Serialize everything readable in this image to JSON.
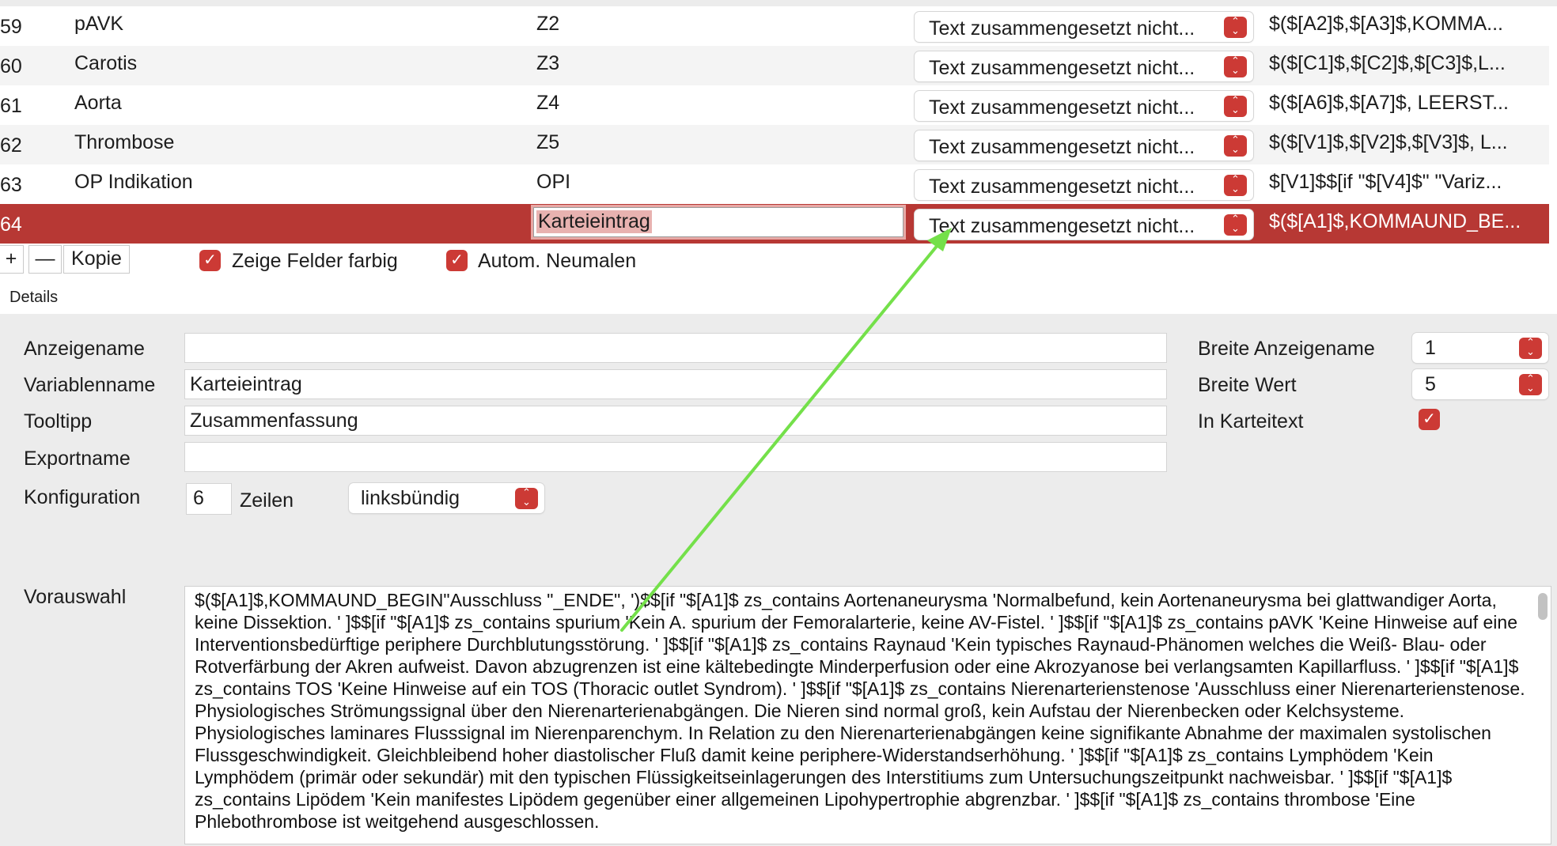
{
  "table": {
    "rows": [
      {
        "num": "59",
        "name": "pAVK",
        "var": "Z2",
        "function": "Text zusammengesetzt nicht...",
        "formula": "$($[A2]$,$[A3]$,KOMMA..."
      },
      {
        "num": "60",
        "name": "Carotis",
        "var": "Z3",
        "function": "Text zusammengesetzt nicht...",
        "formula": "$($[C1]$,$[C2]$,$[C3]$,L..."
      },
      {
        "num": "61",
        "name": "Aorta",
        "var": "Z4",
        "function": "Text zusammengesetzt nicht...",
        "formula": "$($[A6]$,$[A7]$, LEERST..."
      },
      {
        "num": "62",
        "name": "Thrombose",
        "var": "Z5",
        "function": "Text zusammengesetzt nicht...",
        "formula": "$($[V1]$,$[V2]$,$[V3]$, L..."
      },
      {
        "num": "63",
        "name": "OP Indikation",
        "var": "OPI",
        "function": "Text zusammengesetzt nicht...",
        "formula": "$[V1]$$[if \"$[V4]$\" \"Variz..."
      },
      {
        "num": "64",
        "name": "",
        "var": "Karteieintrag",
        "function": "Text zusammengesetzt nicht...",
        "formula": "$($[A1]$,KOMMAUND_BE..."
      }
    ]
  },
  "toolbar": {
    "add_label": "+",
    "remove_label": "—",
    "copy_label": "Kopie",
    "show_colors_label": "Zeige Felder farbig",
    "auto_repaint_label": "Autom. Neumalen",
    "show_colors_checked": true,
    "auto_repaint_checked": true
  },
  "details": {
    "section_title": "Details",
    "display_name_label": "Anzeigename",
    "display_name_value": "",
    "variable_name_label": "Variablenname",
    "variable_name_value": "Karteieintrag",
    "tooltip_label": "Tooltipp",
    "tooltip_value": "Zusammenfassung",
    "export_name_label": "Exportname",
    "export_name_value": "",
    "config_label": "Konfiguration",
    "config_lines_value": "6",
    "config_lines_unit": "Zeilen",
    "alignment_value": "linksbündig",
    "width_display_label": "Breite Anzeigename",
    "width_display_value": "1",
    "width_value_label": "Breite Wert",
    "width_value_value": "5",
    "in_record_label": "In Karteitext",
    "in_record_checked": true,
    "preselection_label": "Vorauswahl",
    "preselection_text": "$($[A1]$,KOMMAUND_BEGIN\"Ausschluss \"_ENDE\", ')$$[if \"$[A1]$ zs_contains Aortenaneurysma 'Normalbefund, kein Aortenaneurysma bei glattwandiger Aorta, keine Dissektion. ' ]$$[if \"$[A1]$ zs_contains spurium 'Kein A. spurium der Femoralarterie, keine AV-Fistel. ' ]$$[if \"$[A1]$ zs_contains pAVK 'Keine Hinweise auf eine Interventionsbedürftige periphere Durchblutungsstörung. ' ]$$[if \"$[A1]$ zs_contains Raynaud 'Kein typisches Raynaud-Phänomen welches die Weiß- Blau- oder Rotverfärbung der Akren aufweist. Davon abzugrenzen ist eine kältebedingte Minderperfusion oder eine Akrozyanose bei verlangsamten Kapillarfluss. ' ]$$[if \"$[A1]$ zs_contains TOS 'Keine Hinweise auf ein TOS (Thoracic outlet Syndrom). ' ]$$[if \"$[A1]$ zs_contains Nierenarterienstenose 'Ausschluss einer Nierenarterienstenose. Physiologisches Strömungssignal über den Nierenarterienabgängen. Die Nieren sind normal groß, kein Aufstau der Nierenbecken oder Kelchsysteme. Physiologisches laminares Flusssignal im Nierenparenchym. In Relation zu den Nierenarterienabgängen keine signifikante Abnahme der maximalen systolischen Flussgeschwindigkeit. Gleichbleibend hoher diastolischer Fluß damit keine periphere-Widerstandserhöhung. ' ]$$[if \"$[A1]$ zs_contains Lymphödem 'Kein Lymphödem (primär oder sekundär) mit den typischen Flüssigkeitseinlagerungen des Interstitiums zum Untersuchungszeitpunkt nachweisbar. ' ]$$[if \"$[A1]$ zs_contains Lipödem 'Kein manifestes Lipödem gegenüber einer allgemeinen Lipohypertrophie abgrenzbar. ' ]$$[if \"$[A1]$ zs_contains thrombose 'Eine Phlebothrombose ist weitgehend ausgeschlossen."
  },
  "colors": {
    "accent": "#cc3a35",
    "selected_row": "#b73834",
    "annotation_arrow": "#74e04a"
  }
}
